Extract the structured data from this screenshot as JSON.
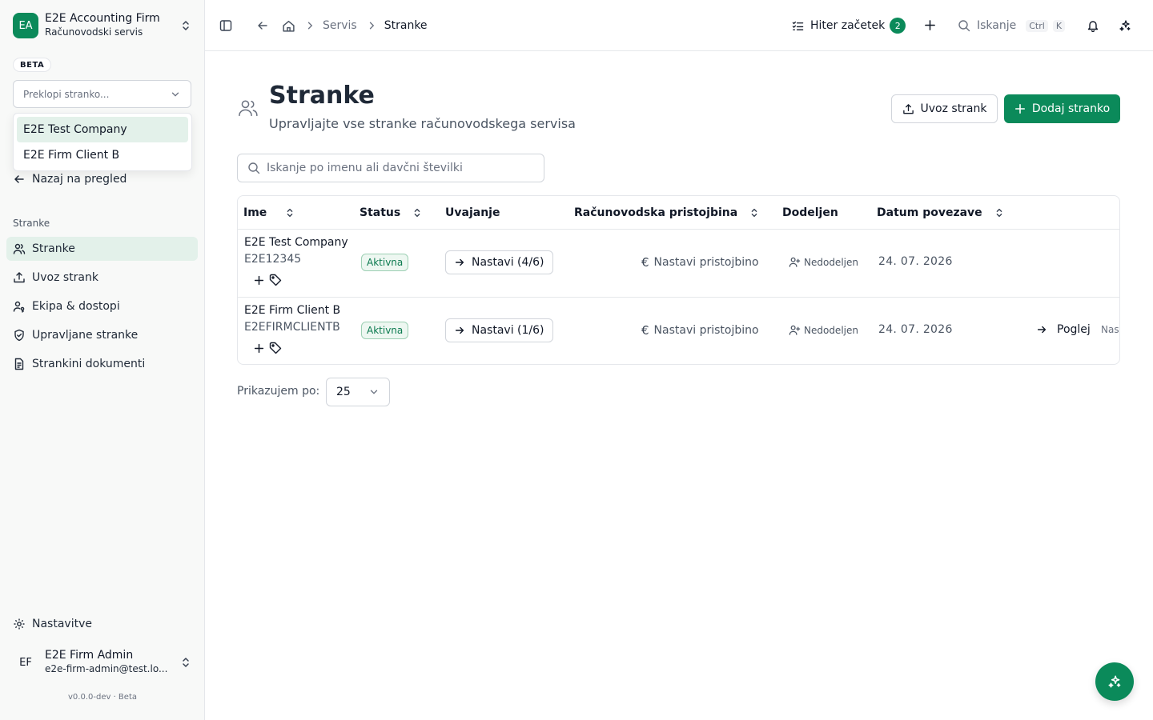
{
  "org": {
    "initials": "EA",
    "name": "E2E Accounting Firm",
    "subtitle": "Računovodski servis"
  },
  "beta_badge": "BETA",
  "client_switcher": {
    "placeholder": "Preklopi stranko...",
    "options": [
      "E2E Test Company",
      "E2E Firm Client B"
    ]
  },
  "back_link": "Nazaj na pregled",
  "nav": {
    "section_label": "Stranke",
    "items": [
      {
        "label": "Stranke",
        "icon": "users-icon",
        "active": true
      },
      {
        "label": "Uvoz strank",
        "icon": "upload-icon"
      },
      {
        "label": "Ekipa & dostopi",
        "icon": "user-key-icon"
      },
      {
        "label": "Upravljane stranke",
        "icon": "shield-check-icon"
      },
      {
        "label": "Strankini dokumenti",
        "icon": "document-icon"
      }
    ]
  },
  "settings_label": "Nastavitve",
  "user": {
    "initials": "EF",
    "name": "E2E Firm Admin",
    "email": "e2e-firm-admin@test.lo..."
  },
  "version": "v0.0.0-dev · Beta",
  "topbar": {
    "breadcrumb": [
      "Servis",
      "Stranke"
    ],
    "quick_start": {
      "label": "Hiter začetek",
      "count": "2"
    },
    "search": {
      "label": "Iskanje",
      "kbd1": "Ctrl",
      "kbd2": "K"
    }
  },
  "page": {
    "title": "Stranke",
    "subtitle": "Upravljajte vse stranke računovodskega servisa",
    "import_button": "Uvoz strank",
    "add_button": "Dodaj stranko",
    "search_placeholder": "Iskanje po imenu ali davčni številki"
  },
  "table": {
    "columns": [
      "Ime",
      "Status",
      "Uvajanje",
      "Računovodska pristojbina",
      "Dodeljen",
      "Datum povezave"
    ],
    "rows": [
      {
        "name": "E2E Test Company",
        "tax_id": "E2E12345",
        "status": "Aktivna",
        "onboarding": "Nastavi (4/6)",
        "fee": "Nastavi pristojbino",
        "assignee": "Nedodeljen",
        "date": "24. 07. 2026"
      },
      {
        "name": "E2E Firm Client B",
        "tax_id": "E2EFIRMCLIENTB",
        "status": "Aktivna",
        "onboarding": "Nastavi (1/6)",
        "fee": "Nastavi pristojbino",
        "assignee": "Nedodeljen",
        "date": "24. 07. 2026",
        "view": "Poglej",
        "overflow": "Nast"
      }
    ]
  },
  "pagination": {
    "label": "Prikazujem po:",
    "value": "25"
  },
  "colors": {
    "accent": "#0b8a5a",
    "active_bg": "#e3f1ea"
  }
}
